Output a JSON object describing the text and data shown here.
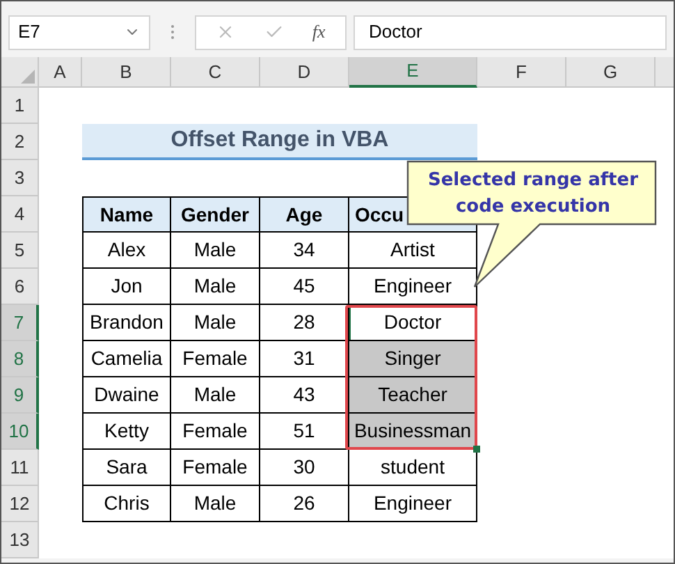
{
  "formula_bar": {
    "name_box": "E7",
    "function_label": "fx",
    "formula": "Doctor"
  },
  "columns": [
    {
      "label": "A",
      "selected": false
    },
    {
      "label": "B",
      "selected": false
    },
    {
      "label": "C",
      "selected": false
    },
    {
      "label": "D",
      "selected": false
    },
    {
      "label": "E",
      "selected": true
    },
    {
      "label": "F",
      "selected": false
    },
    {
      "label": "G",
      "selected": false
    }
  ],
  "row_numbers": [
    {
      "label": "1",
      "selected": false
    },
    {
      "label": "2",
      "selected": false
    },
    {
      "label": "3",
      "selected": false
    },
    {
      "label": "4",
      "selected": false
    },
    {
      "label": "5",
      "selected": false
    },
    {
      "label": "6",
      "selected": false
    },
    {
      "label": "7",
      "selected": true
    },
    {
      "label": "8",
      "selected": true
    },
    {
      "label": "9",
      "selected": true
    },
    {
      "label": "10",
      "selected": true
    },
    {
      "label": "11",
      "selected": false
    },
    {
      "label": "12",
      "selected": false
    },
    {
      "label": "13",
      "selected": false
    }
  ],
  "title": "Offset Range in VBA",
  "table": {
    "columns": [
      "Name",
      "Gender",
      "Age",
      "Occu"
    ],
    "rows": [
      {
        "cells": [
          "Alex",
          "Male",
          "34",
          "Artist"
        ],
        "selected": false,
        "active": false
      },
      {
        "cells": [
          "Jon",
          "Male",
          "45",
          "Engineer"
        ],
        "selected": false,
        "active": false
      },
      {
        "cells": [
          "Brandon",
          "Male",
          "28",
          "Doctor"
        ],
        "selected": true,
        "active": true
      },
      {
        "cells": [
          "Camelia",
          "Female",
          "31",
          "Singer"
        ],
        "selected": true,
        "active": false
      },
      {
        "cells": [
          "Dwaine",
          "Male",
          "43",
          "Teacher"
        ],
        "selected": true,
        "active": false
      },
      {
        "cells": [
          "Ketty",
          "Female",
          "51",
          "Businessman"
        ],
        "selected": true,
        "active": false
      },
      {
        "cells": [
          "Sara",
          "Female",
          "30",
          "student"
        ],
        "selected": false,
        "active": false
      },
      {
        "cells": [
          "Chris",
          "Male",
          "26",
          "Engineer"
        ],
        "selected": false,
        "active": false
      }
    ]
  },
  "callout": "Selected range after code execution"
}
